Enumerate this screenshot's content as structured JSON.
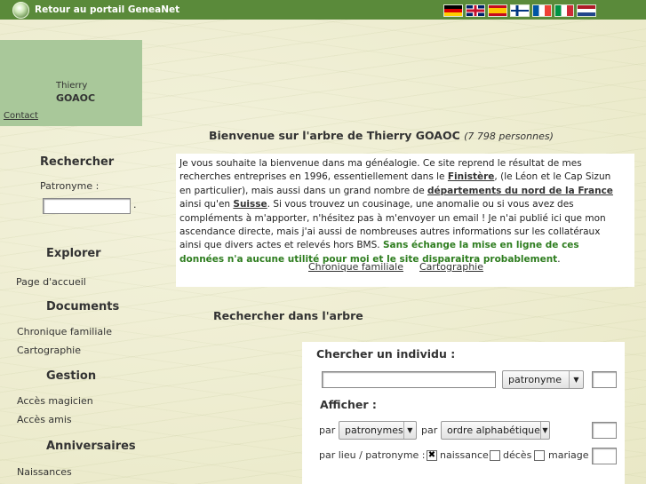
{
  "topbar": {
    "portal_link": "Retour au portail GeneaNet",
    "flags": [
      "de",
      "en",
      "es",
      "fi",
      "fr",
      "it",
      "nl"
    ]
  },
  "owner": {
    "first_name": "Thierry",
    "last_name": "GOAOC",
    "contact": "Contact"
  },
  "sidebar": {
    "search_heading": "Rechercher",
    "patronyme_label": "Patronyme :",
    "patronyme_value": "",
    "explore_heading": "Explorer",
    "home_link": "Page d'accueil",
    "documents_heading": "Documents",
    "chronicle_link": "Chronique familiale",
    "map_link": "Cartographie",
    "manage_heading": "Gestion",
    "magicians_link": "Accès magicien",
    "friends_link": "Accès amis",
    "anniv_heading": "Anniversaires",
    "births_link": "Naissances"
  },
  "welcome": {
    "title": "Bienvenue sur l'arbre de Thierry GOAOC",
    "count": "(7 798 personnes)",
    "p1": "Je vous souhaite la bienvenue dans ma généalogie. Ce site reprend le résultat de mes recherches entreprises en 1996, essentiellement dans le ",
    "finistere": "Finistère",
    "p2": ", (le Léon et le Cap Sizun en particulier), mais aussi dans un grand nombre de ",
    "departements": "départements du nord de la France",
    "p3": " ainsi qu'en ",
    "suisse": "Suisse",
    "p4": ". Si vous trouvez un cousinage, une anomalie ou si vous avez des compléments à m'apporter, n'hésitez pas à m'envoyer un email ! Je n'ai publié ici que mon ascendance directe, mais j'ai aussi de nombreuses autres informations sur les collatéraux ainsi que divers actes et relevés hors BMS. ",
    "warning": "Sans échange la mise en ligne de ces données n'a aucune utilité pour moi et le site disparaitra probablement",
    "p5": ".",
    "link_chronicle": "Chronique familiale",
    "link_map": "Cartographie"
  },
  "search": {
    "title": "Rechercher dans l'arbre",
    "individual_heading": "Chercher un individu :",
    "individual_value": "",
    "individual_select": "patronyme",
    "individual_small_value": "",
    "afficher_heading": "Afficher :",
    "par1": "par",
    "select1": "patronymes",
    "par2": "par",
    "select2": "ordre alphabétique",
    "afficher_small_value": "",
    "lieu_label": "par lieu / patronyme :",
    "cb_naissance_label": "naissance",
    "cb_naissance_checked": true,
    "cb_deces_label": "décès",
    "cb_deces_checked": false,
    "cb_mariage_label": "mariage",
    "cb_mariage_checked": false,
    "lieu_small_value": ""
  }
}
